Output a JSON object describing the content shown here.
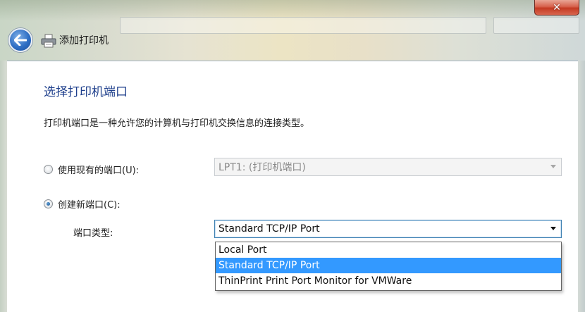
{
  "window": {
    "title": "添加打印机",
    "close_glyph": "✕"
  },
  "page": {
    "heading": "选择打印机端口",
    "description": "打印机端口是一种允许您的计算机与打印机交换信息的连接类型。"
  },
  "options": {
    "existing_port": {
      "label": "使用现有的端口(U):",
      "selected": false,
      "value": "LPT1: (打印机端口)"
    },
    "new_port": {
      "label": "创建新端口(C):",
      "selected": true
    },
    "port_type": {
      "label": "端口类型:",
      "value": "Standard TCP/IP Port",
      "items": [
        "Local Port",
        "Standard TCP/IP Port",
        "ThinPrint Print Port Monitor for VMWare"
      ],
      "highlighted_index": 1
    }
  },
  "colors": {
    "heading": "#1e3f8c",
    "selection": "#3399ff",
    "close_button": "#c43a22"
  }
}
